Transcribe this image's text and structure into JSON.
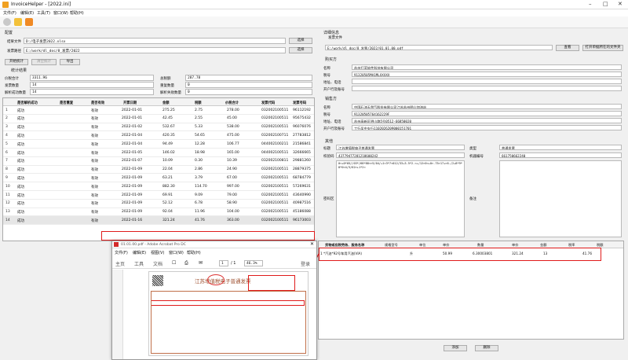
{
  "app": {
    "title": "InvoiceHelper - [2022.ini]"
  },
  "menu": [
    "文件(F)",
    "编辑(E)",
    "工具(T)",
    "窗口(W)",
    "帮助(H)"
  ],
  "toolbar": {
    "icons": [
      "settings-icon",
      "folder-open-icon",
      "save-icon"
    ]
  },
  "overview": {
    "group": "配置",
    "result_file_label": "结果文件",
    "result_file_value": "D:/电子发票2022.xlsx",
    "invoice_dir_label": "发票路径",
    "invoice_dir_value": "E:/work/dl_doc/8_发票/2022",
    "browse": "选择",
    "start": "开始统计",
    "clear": "清空统计",
    "export": "导出"
  },
  "stats": {
    "group": "统计结果",
    "total_label": "价税合计",
    "total_value": "3311.96",
    "tax_label": "总税额",
    "tax_value": "287.78",
    "count_label": "发票数量",
    "count_value": "14",
    "dup_label": "重复数量",
    "dup_value": "0",
    "ok_label": "解析成功数量",
    "ok_value": "14",
    "fail_label": "解析失败数量",
    "fail_value": "0"
  },
  "table": {
    "headers": [
      "",
      "是否解析成功",
      "是否重复",
      "是否有效",
      "开票日期",
      "金额",
      "税额",
      "价税合计",
      "发票代码",
      "发票号码"
    ],
    "rows": [
      [
        "1",
        "成功",
        "",
        "有效",
        "2022-01-01",
        "275.25",
        "2.75",
        "278.00",
        "032002100511",
        "96112192"
      ],
      [
        "2",
        "成功",
        "",
        "有效",
        "2022-01-01",
        "42.45",
        "2.55",
        "45.00",
        "032002100511",
        "95675432"
      ],
      [
        "3",
        "成功",
        "",
        "有效",
        "2022-01-02",
        "532.67",
        "5.33",
        "538.00",
        "032002100511",
        "96076076"
      ],
      [
        "4",
        "成功",
        "",
        "有效",
        "2022-01-04",
        "420.35",
        "54.65",
        "475.00",
        "032002100711",
        "27783812"
      ],
      [
        "5",
        "成功",
        "",
        "有效",
        "2022-01-04",
        "94.49",
        "12.28",
        "106.77",
        "044002100211",
        "21586841"
      ],
      [
        "6",
        "成功",
        "",
        "有效",
        "2022-01-05",
        "146.02",
        "18.98",
        "165.00",
        "044002100511",
        "32666665"
      ],
      [
        "7",
        "成功",
        "",
        "有效",
        "2022-01-07",
        "10.09",
        "0.30",
        "10.39",
        "032002100811",
        "29881260"
      ],
      [
        "8",
        "成功",
        "",
        "有效",
        "2022-01-09",
        "22.04",
        "2.86",
        "24.90",
        "032002100511",
        "28879375"
      ],
      [
        "9",
        "成功",
        "",
        "有效",
        "2022-01-09",
        "63.21",
        "3.79",
        "67.00",
        "032002100511",
        "68784779"
      ],
      [
        "10",
        "成功",
        "",
        "有效",
        "2022-01-09",
        "882.30",
        "114.70",
        "997.00",
        "032002100511",
        "57269631"
      ],
      [
        "11",
        "成功",
        "",
        "有效",
        "2022-01-09",
        "69.91",
        "9.09",
        "79.00",
        "032002100511",
        "43640990"
      ],
      [
        "12",
        "成功",
        "",
        "有效",
        "2022-01-09",
        "52.12",
        "6.78",
        "58.90",
        "032002100511",
        "40987516"
      ],
      [
        "13",
        "成功",
        "",
        "有效",
        "2022-01-09",
        "92.04",
        "11.96",
        "104.00",
        "032002100511",
        "45186088"
      ],
      [
        "14",
        "成功",
        "",
        "有效",
        "2022-01-16",
        "321.24",
        "41.76",
        "363.00",
        "032002100511",
        "96173003"
      ]
    ]
  },
  "detail": {
    "group": "详细信息",
    "file_label": "发票文件",
    "file_value": "E:/work/dl_doc/8_发票/2022/01.01.00.pdf",
    "view": "查看",
    "open_folder": "打开单据所在的文件夹",
    "buyer_group": "购买方",
    "buyer": {
      "name_label": "名称",
      "name": "苏州打蓝软件科技有限公司",
      "tax_label": "税号",
      "tax": "91320505MA1MLXXXXX",
      "addr_label": "地址、电话",
      "addr": "",
      "bank_label": "开户行及账号",
      "bank": ""
    },
    "seller_group": "销售方",
    "seller": {
      "name_label": "名称",
      "name": "中国石油天然气股份有限公司江苏苏州明山加油站",
      "tax_label": "税号",
      "tax": "91320505764162229F",
      "addr_label": "地址、电话",
      "addr": "苏州高新区明山路5号0512-66850020",
      "bank_label": "开户行及账号",
      "bank": "工行吴中支行1102026209000151701"
    },
    "other_group": "其他",
    "title_label": "标题",
    "title": "江苏增值税电子普通发票",
    "type_label": "类型",
    "type": "普通发票",
    "check_label": "校验码",
    "check": "43779477281218600242",
    "machine_label": "机器编号",
    "machine": "661750662240",
    "pwd_label": "密码区",
    "pwd": "0<+0*05//03*/68*88<>5/04/+1<3*7<012/33+3-5*2-<+/12>0<+0>-75>17+>6-/2+8*9*8*0&lt;4/3/62&gt;+1*2&lt;<br>",
    "remark_label": "备注",
    "remark": ""
  },
  "items": {
    "headers": [
      "",
      "货物或应税劳务、服务名称",
      "规格型号",
      "单位",
      "单价",
      "数量",
      "单价",
      "金额",
      "税率",
      "税额"
    ],
    "row": [
      "1",
      "*汽油*92号车用汽油(VIA)",
      "",
      "升",
      "50.99",
      "6.30003801",
      "",
      "321.24",
      "13",
      "41.76"
    ],
    "add": "添加",
    "delete": "删除"
  },
  "pdf": {
    "title": "01.01.00.pdf - Adobe Acrobat Pro DC",
    "menu": [
      "文件(F)",
      "编辑(E)",
      "视图(V)",
      "窗口(W)",
      "帮助(H)"
    ],
    "tabs": [
      "主页",
      "工具",
      "文档"
    ],
    "page": "1",
    "pages": "/ 1",
    "zoom": "46.3%",
    "signin": "登录",
    "invoice_title": "江苏增值税电子普通发票"
  }
}
